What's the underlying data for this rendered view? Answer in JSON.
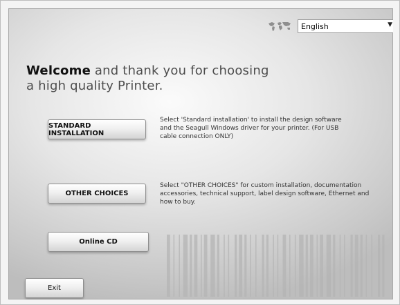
{
  "language": {
    "selected": "English",
    "globe_icon": "world-map-icon"
  },
  "welcome": {
    "bold": "Welcome",
    "rest_line1": " and thank you for choosing",
    "line2": "a high quality Printer."
  },
  "buttons": {
    "standard": "STANDARD INSTALLATION",
    "other": "OTHER CHOICES",
    "online_cd": "Online CD",
    "exit": "Exit"
  },
  "descriptions": {
    "standard": [
      "Select 'Standard installation' to install the design software",
      "and the Seagull Windows driver for your printer. (For USB",
      "cable connection ONLY)"
    ],
    "other": [
      "Select \"OTHER CHOICES\" for custom installation, documentation",
      "accessories, technical support, label design software, Ethernet and",
      "how to buy."
    ]
  },
  "colors": {
    "panel": "#dcdcdc",
    "text": "#4d4d4d",
    "barcode": "#b4b4b4"
  }
}
